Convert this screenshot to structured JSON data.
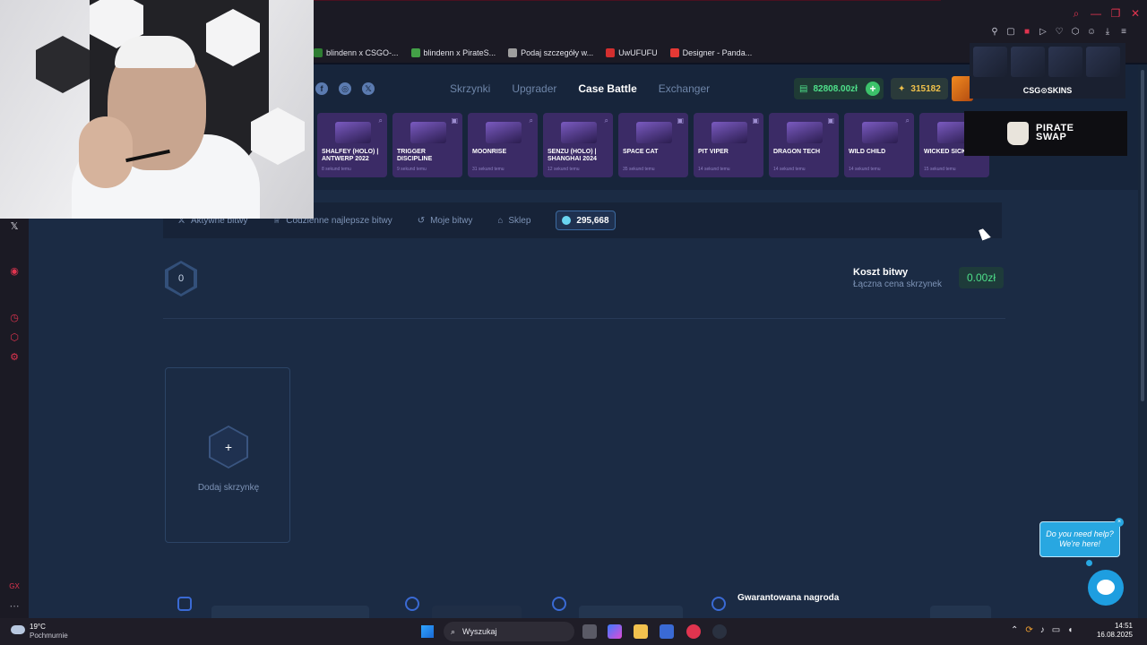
{
  "window": {
    "controls": [
      "search-icon",
      "minimize-icon",
      "restore-icon",
      "close-icon"
    ]
  },
  "bookmarks": [
    {
      "label": "blindenn x CSGO-...",
      "color": "#2e7d32"
    },
    {
      "label": "blindenn x PirateS...",
      "color": "#43a047"
    },
    {
      "label": "Podaj szczegóły w...",
      "color": "#9e9e9e"
    },
    {
      "label": "UwUFUFU",
      "color": "#d32f2f"
    },
    {
      "label": "Designer - Panda...",
      "color": "#e53935"
    }
  ],
  "site": {
    "social": [
      "facebook-icon",
      "instagram-icon",
      "x-icon"
    ],
    "social_glyphs": {
      "facebook": "f",
      "instagram": "◎",
      "x": "𝕏"
    },
    "nav": [
      {
        "label": "Skrzynki",
        "active": false
      },
      {
        "label": "Upgrader",
        "active": false
      },
      {
        "label": "Case Battle",
        "active": true
      },
      {
        "label": "Exchanger",
        "active": false
      }
    ],
    "balance": "82808.00zł",
    "balance_add": "+",
    "coins": "315182",
    "accent_green": "#4ee08a",
    "accent_gold": "#f0c14b"
  },
  "cases": [
    {
      "name": "SHALFEY (HOLO) | ANTWERP 2022",
      "time": "8 sekund temu"
    },
    {
      "name": "TRIGGER DISCIPLINE",
      "time": "9 sekund temu"
    },
    {
      "name": "MOONRISE",
      "time": "31 sekund temu"
    },
    {
      "name": "SENZU (HOLO) | SHANGHAI 2024",
      "time": "12 sekund temu"
    },
    {
      "name": "SPACE CAT",
      "time": "35 sekund temu"
    },
    {
      "name": "PIT VIPER",
      "time": "14 sekund temu"
    },
    {
      "name": "DRAGON TECH",
      "time": "14 sekund temu"
    },
    {
      "name": "WILD CHILD",
      "time": "14 sekund temu"
    },
    {
      "name": "WICKED SICK",
      "time": "15 sekund temu"
    }
  ],
  "subnav": {
    "active_battles": "Aktywne bitwy",
    "daily_best": "Codzienne najlepsze bitwy",
    "my_battles": "Moje bitwy",
    "shop": "Sklep",
    "gems": "295,668"
  },
  "battle": {
    "rounds": "0",
    "cost_title": "Koszt bitwy",
    "cost_subtitle": "Łączna cena skrzynek",
    "cost_value": "0.00zł",
    "add_case_label": "Dodaj skrzynkę",
    "add_case_plus": "+",
    "guarantee": "Gwarantowana nagroda"
  },
  "ads": {
    "top_title": "CSG⊙SKINS",
    "bottom_brand_line1": "PIRATE",
    "bottom_brand_line2": "SWAP"
  },
  "chat": {
    "bubble_line1": "Do you need help?",
    "bubble_line2": "We're here!",
    "close": "×"
  },
  "taskbar": {
    "temperature": "19°C",
    "weather": "Pochmurnie",
    "search": "Wyszukaj",
    "time": "14:51",
    "date": "16.08.2025"
  }
}
